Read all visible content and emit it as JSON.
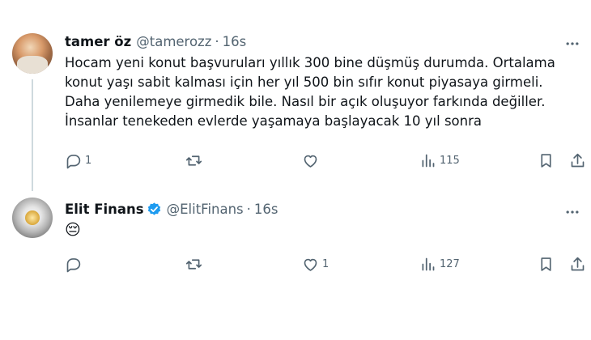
{
  "tweets": [
    {
      "author_name": "tamer öz",
      "handle": "@tamerozz",
      "separator": "·",
      "time": "16s",
      "verified": false,
      "text_lines": [
        "Hocam yeni konut başvuruları yıllık 300 bine düşmüş durumda. Ortalama",
        "konut yaşı sabit kalması için her yıl 500 bin sıfır konut piyasaya girmeli.",
        "Daha yenilemeye girmedik bile. Nasıl bir açık oluşuyor farkında değiller.",
        "İnsanlar tenekeden evlerde yaşamaya başlayacak 10 yıl sonra"
      ],
      "replies": "1",
      "retweets": "",
      "likes": "",
      "views": "115"
    },
    {
      "author_name": "Elit Finans",
      "handle": "@ElitFinans",
      "separator": "·",
      "time": "16s",
      "verified": true,
      "text_lines": [
        "😔"
      ],
      "replies": "",
      "retweets": "",
      "likes": "1",
      "views": "127"
    }
  ],
  "colors": {
    "text": "#0f1419",
    "secondary": "#536471",
    "verified_badge": "#1d9bf0",
    "thread_line": "#cfd9de"
  },
  "icons": [
    "more-icon",
    "reply-icon",
    "retweet-icon",
    "like-icon",
    "views-icon",
    "bookmark-icon",
    "share-icon",
    "verified-badge-icon"
  ]
}
